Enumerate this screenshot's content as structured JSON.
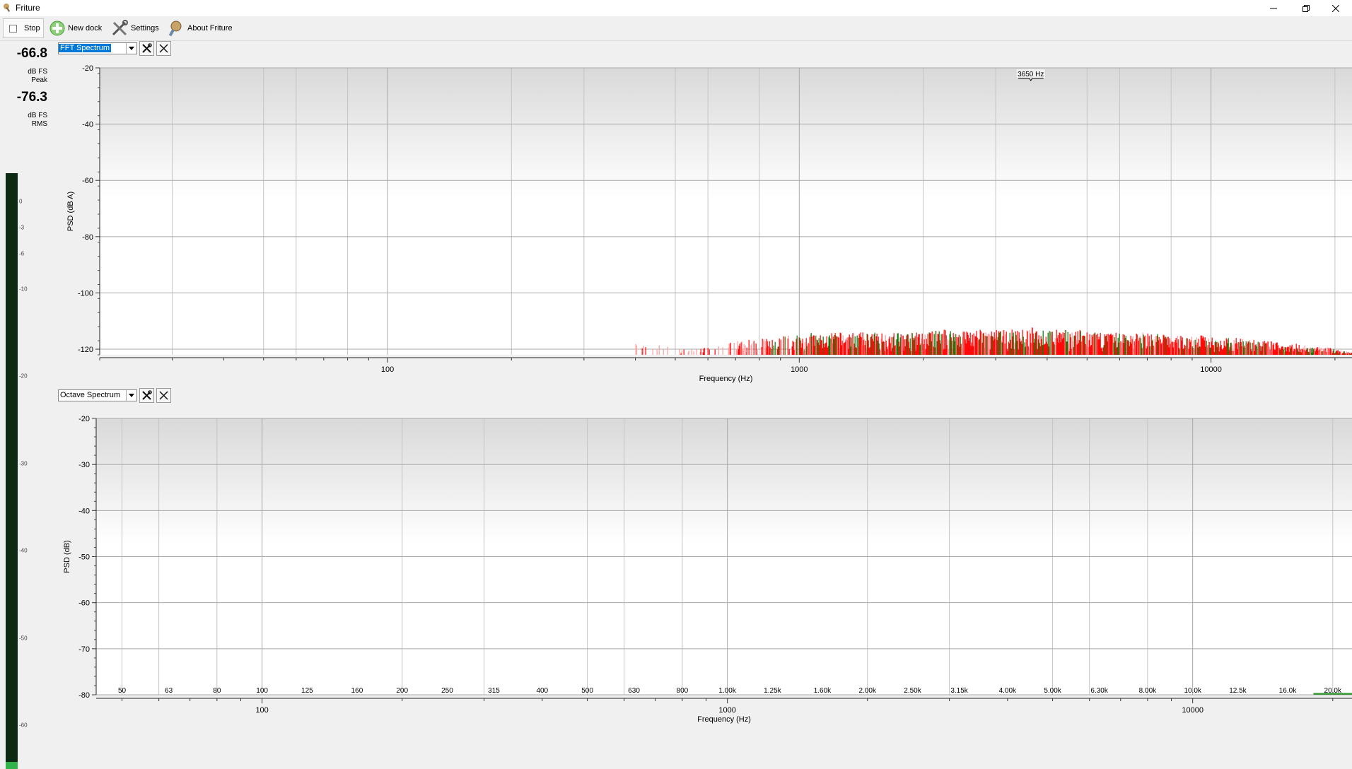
{
  "window": {
    "title": "Friture",
    "icon": "friture-logo-icon",
    "controls": [
      "minimize-icon",
      "restore-icon",
      "close-icon"
    ]
  },
  "toolbar": {
    "stop_label": "Stop",
    "stop_checked": false,
    "new_dock_label": "New dock",
    "settings_label": "Settings",
    "about_label": "About Friture"
  },
  "levels": {
    "peak_value": "-66.8",
    "peak_unit": "dB FS",
    "peak_label": "Peak",
    "rms_value": "-76.3",
    "rms_unit": "dB FS",
    "rms_label": "RMS",
    "scale_ticks": [
      "0",
      "-3",
      "-6",
      "-10",
      "-20",
      "-30",
      "-40",
      "-50",
      "-60"
    ],
    "meter_fill_fraction": 0.012,
    "meter_fill_color": "#31b24a"
  },
  "docks": {
    "fft": {
      "selected_widget": "FFT Spectrum",
      "settings_icon": "tools-icon",
      "close_icon": "close-icon"
    },
    "octave": {
      "selected_widget": "Octave Spectrum",
      "settings_icon": "tools-icon",
      "close_icon": "close-icon"
    }
  },
  "chart_data": [
    {
      "type": "bar",
      "xlabel": "Frequency (Hz)",
      "ylabel": "PSD (dB A)",
      "x_scale": "log",
      "xlim": [
        20,
        22000
      ],
      "ylim": [
        -122,
        -20
      ],
      "y_ticks": [
        "-20",
        "-40",
        "-60",
        "-80",
        "-100",
        "-120"
      ],
      "x_ticks": [
        "100",
        "1000",
        "10000"
      ],
      "grid": true,
      "peak_annotation": "3650 Hz",
      "peak_annotation_freq": 3650,
      "series": [
        {
          "color": "#ff0000"
        },
        {
          "color": "#ff9a9a"
        },
        {
          "color": "#007a00"
        }
      ],
      "spectrum": [
        [
          400,
          -118
        ],
        [
          440,
          -118
        ],
        [
          480,
          -119
        ],
        [
          520,
          -120
        ],
        [
          560,
          -120
        ],
        [
          600,
          -119
        ],
        [
          640,
          -118
        ],
        [
          680,
          -117
        ],
        [
          720,
          -117
        ],
        [
          760,
          -116
        ],
        [
          800,
          -116
        ],
        [
          860,
          -116
        ],
        [
          920,
          -115
        ],
        [
          990,
          -115
        ],
        [
          1060,
          -114
        ],
        [
          1140,
          -115
        ],
        [
          1220,
          -114
        ],
        [
          1310,
          -114
        ],
        [
          1410,
          -114
        ],
        [
          1510,
          -114
        ],
        [
          1620,
          -114
        ],
        [
          1740,
          -114
        ],
        [
          1870,
          -114
        ],
        [
          2010,
          -114
        ],
        [
          2160,
          -113
        ],
        [
          2320,
          -113
        ],
        [
          2500,
          -113
        ],
        [
          2680,
          -113
        ],
        [
          2880,
          -113
        ],
        [
          3100,
          -113
        ],
        [
          3330,
          -113
        ],
        [
          3580,
          -113
        ],
        [
          3650,
          -112
        ],
        [
          3850,
          -113
        ],
        [
          4130,
          -113
        ],
        [
          4440,
          -113
        ],
        [
          4770,
          -113
        ],
        [
          5130,
          -114
        ],
        [
          5510,
          -114
        ],
        [
          5920,
          -114
        ],
        [
          6360,
          -114
        ],
        [
          6840,
          -114
        ],
        [
          7350,
          -114
        ],
        [
          7900,
          -115
        ],
        [
          8490,
          -115
        ],
        [
          9120,
          -115
        ],
        [
          9800,
          -115
        ],
        [
          10500,
          -116
        ],
        [
          11300,
          -116
        ],
        [
          12200,
          -116
        ],
        [
          13100,
          -117
        ],
        [
          14000,
          -117
        ],
        [
          15100,
          -118
        ],
        [
          16200,
          -118
        ],
        [
          17400,
          -119
        ],
        [
          18700,
          -119
        ],
        [
          20100,
          -120
        ],
        [
          21600,
          -121
        ]
      ]
    },
    {
      "type": "bar",
      "xlabel": "Frequency (Hz)",
      "ylabel": "PSD (dB)",
      "x_scale": "log",
      "xlim": [
        44,
        22000
      ],
      "ylim": [
        -80,
        -20
      ],
      "y_ticks": [
        "-20",
        "-30",
        "-40",
        "-50",
        "-60",
        "-70",
        "-80"
      ],
      "x_ticks": [
        "100",
        "1000",
        "10000"
      ],
      "grid": true,
      "band_labels": [
        "50",
        "63",
        "80",
        "100",
        "125",
        "160",
        "200",
        "250",
        "315",
        "400",
        "500",
        "630",
        "800",
        "1.00k",
        "1.25k",
        "1.60k",
        "2.00k",
        "2.50k",
        "3.15k",
        "4.00k",
        "5.00k",
        "6.30k",
        "8.00k",
        "10.0k",
        "12.5k",
        "16.0k",
        "20.0k"
      ],
      "band_freqs": [
        50,
        63,
        80,
        100,
        125,
        160,
        200,
        250,
        315,
        400,
        500,
        630,
        800,
        1000,
        1250,
        1600,
        2000,
        2500,
        3150,
        4000,
        5000,
        6300,
        8000,
        10000,
        12500,
        16000,
        20000
      ],
      "band_values": [
        -80,
        -80,
        -80,
        -80,
        -80,
        -80,
        -80,
        -80,
        -80,
        -80,
        -80,
        -80,
        -80,
        -80,
        -80,
        -80,
        -80,
        -80,
        -80,
        -80,
        -80,
        -80,
        -80,
        -80,
        -80,
        -80,
        -79.6
      ],
      "bar_color": "#3a9a3a"
    }
  ]
}
